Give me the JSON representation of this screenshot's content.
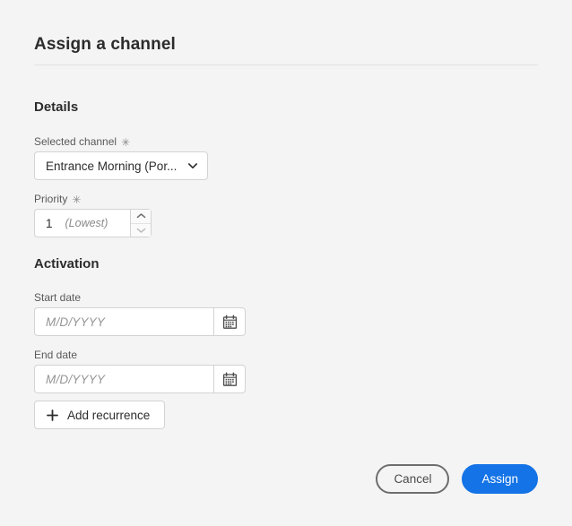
{
  "dialog": {
    "title": "Assign a channel",
    "required_marker": "✳"
  },
  "details": {
    "heading": "Details",
    "selected_channel": {
      "label": "Selected channel",
      "value": "Entrance Morning (Por...",
      "icon": "chevron-down-icon"
    },
    "priority": {
      "label": "Priority",
      "value": "1",
      "hint": "(Lowest)",
      "increment_icon": "chevron-up-icon",
      "decrement_icon": "chevron-down-icon"
    }
  },
  "activation": {
    "heading": "Activation",
    "start_date": {
      "label": "Start date",
      "value": "",
      "placeholder": "M/D/YYYY",
      "icon": "calendar-icon"
    },
    "end_date": {
      "label": "End date",
      "value": "",
      "placeholder": "M/D/YYYY",
      "icon": "calendar-icon"
    },
    "add_recurrence": {
      "label": "Add recurrence",
      "icon": "plus-icon"
    }
  },
  "footer": {
    "cancel_label": "Cancel",
    "assign_label": "Assign"
  },
  "colors": {
    "accent": "#1473e6",
    "background": "#f4f4f4",
    "field_background": "#ffffff",
    "border": "#d3d3d3",
    "text_primary": "#2c2c2c",
    "text_secondary": "#5a5a5a",
    "placeholder": "#959595"
  }
}
